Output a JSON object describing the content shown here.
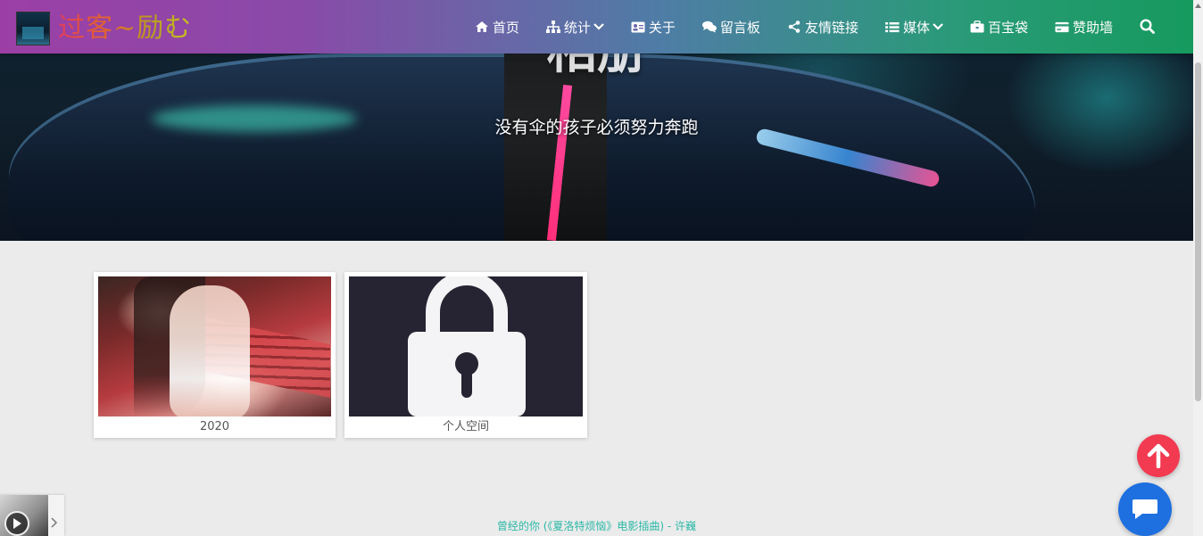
{
  "brand": {
    "title": "过客~励む"
  },
  "nav": {
    "items": [
      {
        "label": "首页",
        "icon": "home-icon"
      },
      {
        "label": "统计",
        "icon": "sitemap-icon",
        "has_dropdown": true
      },
      {
        "label": "关于",
        "icon": "id-card-icon"
      },
      {
        "label": "留言板",
        "icon": "comments-icon"
      },
      {
        "label": "友情链接",
        "icon": "share-icon"
      },
      {
        "label": "媒体",
        "icon": "list-icon",
        "has_dropdown": true
      },
      {
        "label": "百宝袋",
        "icon": "briefcase-icon"
      },
      {
        "label": "赞助墙",
        "icon": "credit-card-icon"
      }
    ],
    "search_icon": "search-icon"
  },
  "hero": {
    "title": "相册",
    "subtitle": "没有伞的孩子必须努力奔跑"
  },
  "albums": [
    {
      "caption": "2020",
      "locked": false
    },
    {
      "caption": "个人空间",
      "locked": true
    }
  ],
  "player": {
    "song": "曾经的你 (《夏洛特烦恼》电影插曲) - 许巍"
  },
  "colors": {
    "back_to_top": "#f23a50",
    "chat": "#1e6fe0",
    "song_text": "#2bb8a6",
    "page_bg": "#ebebeb"
  }
}
